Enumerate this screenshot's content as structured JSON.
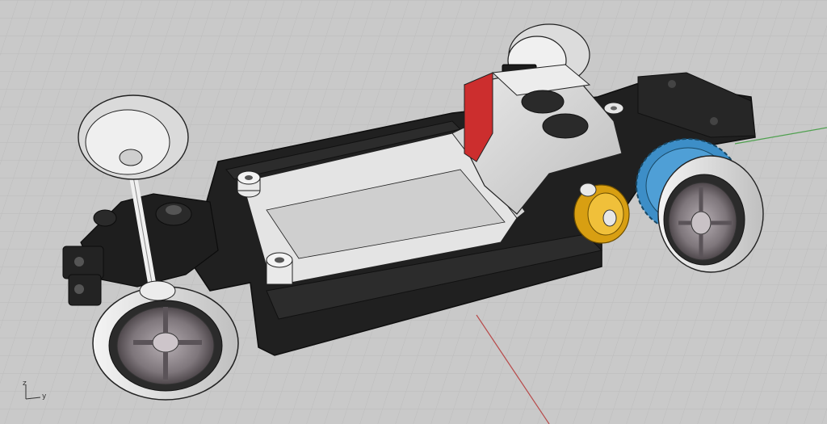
{
  "viewport": {
    "name": "",
    "projection": "perspective",
    "display_mode": "shaded"
  },
  "axes": {
    "z_label": "z",
    "y_label": "y"
  },
  "colors": {
    "background": "#c9c9c9",
    "grid_minor": "#bdbdbd",
    "grid_major": "#b0b0b0",
    "x_axis": "#b84b4b",
    "y_axis": "#4fa04f",
    "chassis": "#1f1f1f",
    "tray": "#e2e2e2",
    "motor": "#dadada",
    "motor_band": "#cc2e2e",
    "pinion": "#e2ad1c",
    "crown_gear": "#3d8ec7",
    "tire": "#ececec",
    "rim": "#8a8288"
  },
  "model": {
    "name": "",
    "parts": [
      "chassis",
      "motor",
      "pinion",
      "crown-gear",
      "front-axle",
      "rear-axle",
      "wheels"
    ]
  }
}
